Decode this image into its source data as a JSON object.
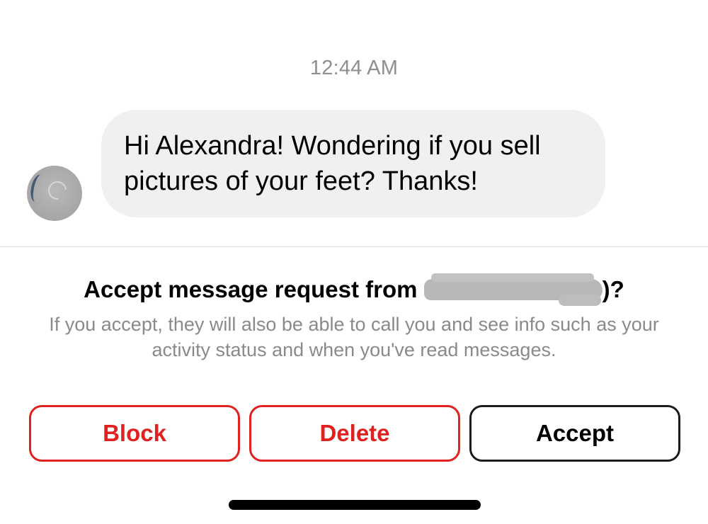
{
  "thread": {
    "timestamp": "12:44 AM",
    "message": {
      "text": "Hi Alexandra! Wondering if you sell pictures of your feet? Thanks!"
    }
  },
  "request": {
    "title_prefix": "Accept message request from ",
    "title_suffix": ")?",
    "subtitle": "If you accept, they will also be able to call you and see info such as your activity status and when you've read messages."
  },
  "actions": {
    "block_label": "Block",
    "delete_label": "Delete",
    "accept_label": "Accept"
  },
  "colors": {
    "destructive": "#e0211f",
    "bubble": "#f0f0f2",
    "secondary_text": "#8a8a8e"
  }
}
